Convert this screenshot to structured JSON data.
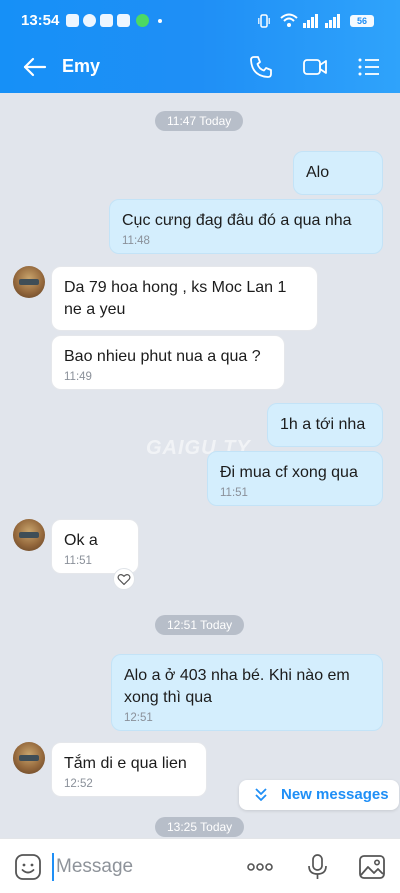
{
  "status": {
    "time": "13:54",
    "battery": "56"
  },
  "header": {
    "contact_name": "Emy"
  },
  "chat": {
    "watermark": "GAIGU.TY",
    "stamps": [
      "11:47 Today",
      "12:51 Today",
      "13:25 Today"
    ],
    "messages": [
      {
        "dir": "out",
        "text": "Alo",
        "time": ""
      },
      {
        "dir": "out",
        "text": "Cục cưng đag đâu đó a qua nha",
        "time": "11:48"
      },
      {
        "dir": "in",
        "text": "Da 79 hoa hong , ks Moc Lan 1 ne a yeu",
        "time": ""
      },
      {
        "dir": "in",
        "text": "Bao nhieu phut nua a qua ?",
        "time": "11:49"
      },
      {
        "dir": "out",
        "text": "1h a tới nha",
        "time": ""
      },
      {
        "dir": "out",
        "text": "Đi mua cf xong qua",
        "time": "11:51"
      },
      {
        "dir": "in",
        "text": "Ok a",
        "time": "11:51"
      },
      {
        "dir": "out",
        "text": "Alo a ở 403 nha bé. Khi nào em xong thì qua",
        "time": "12:51"
      },
      {
        "dir": "in",
        "text": "Tắm di e qua lien",
        "time": "12:52"
      }
    ],
    "new_messages_label": "New messages"
  },
  "input": {
    "placeholder": "Message"
  },
  "colors": {
    "accent": "#1f8ff6",
    "outgoing_bubble": "#d4eefd",
    "incoming_bubble": "#ffffff",
    "chat_bg": "#e1e5ec"
  }
}
